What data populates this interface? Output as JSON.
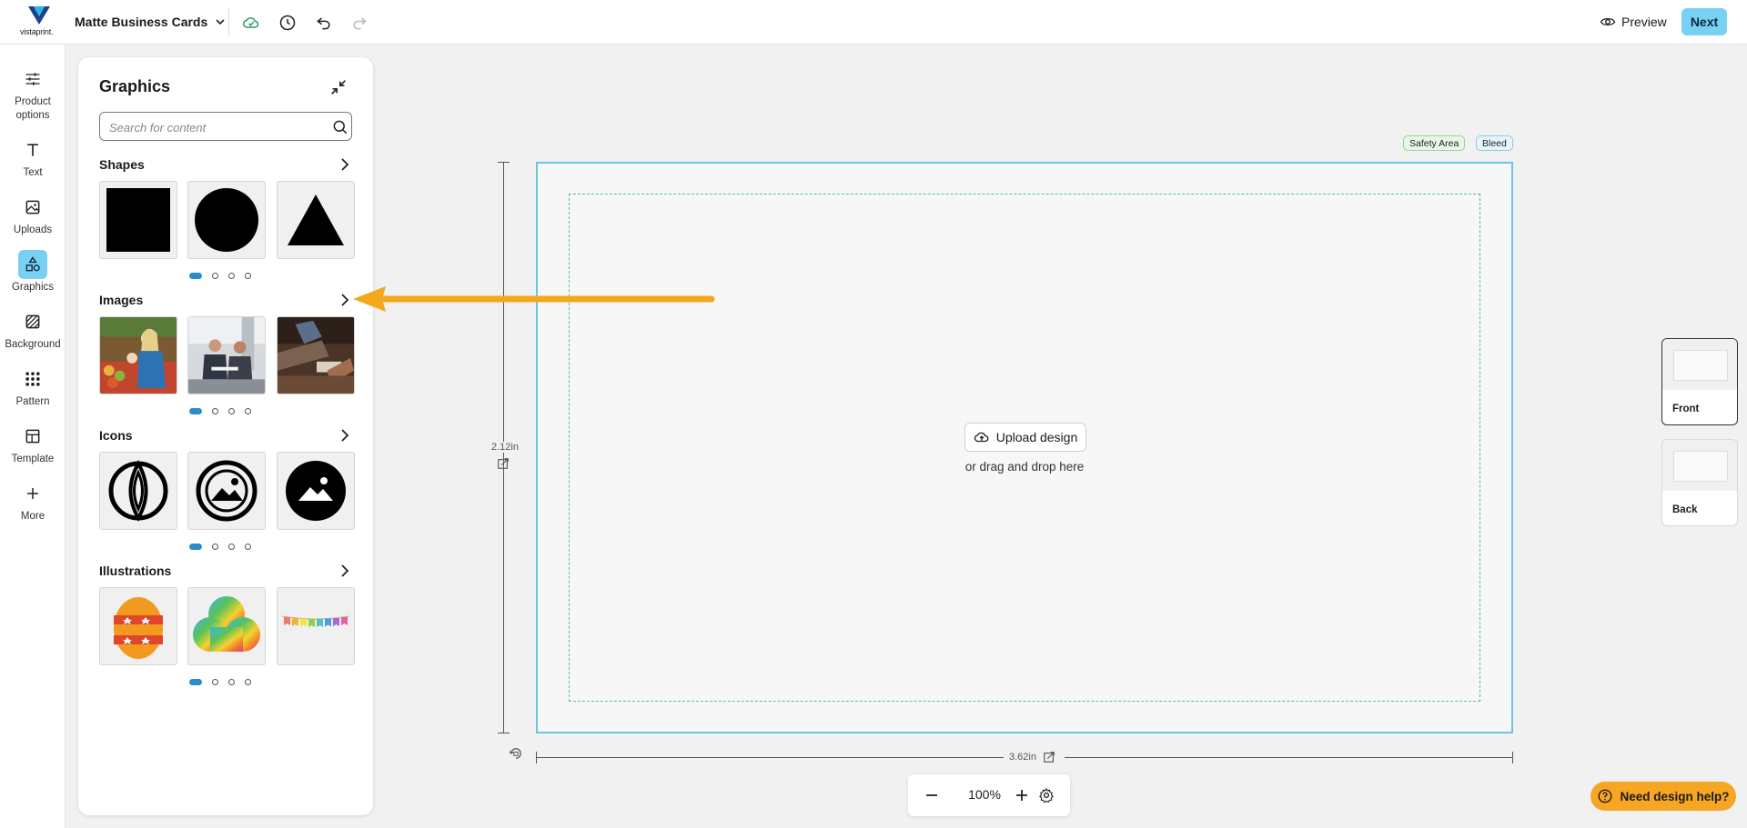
{
  "header": {
    "logo_text": "vistaprint.",
    "product_name": "Matte Business Cards",
    "preview_label": "Preview",
    "next_label": "Next"
  },
  "rail": {
    "items": [
      {
        "label": "Product options",
        "icon": "sliders-icon"
      },
      {
        "label": "Text",
        "icon": "text-icon"
      },
      {
        "label": "Uploads",
        "icon": "image-upload-icon"
      },
      {
        "label": "Graphics",
        "icon": "shapes-icon",
        "active": true
      },
      {
        "label": "Background",
        "icon": "hatch-icon"
      },
      {
        "label": "Pattern",
        "icon": "grid-dots-icon"
      },
      {
        "label": "Template",
        "icon": "template-icon"
      },
      {
        "label": "More",
        "icon": "plus-icon"
      }
    ]
  },
  "panel": {
    "title": "Graphics",
    "search_placeholder": "Search for content",
    "sections": [
      {
        "label": "Shapes"
      },
      {
        "label": "Images"
      },
      {
        "label": "Icons"
      },
      {
        "label": "Illustrations"
      }
    ]
  },
  "canvas": {
    "safety_label": "Safety Area",
    "bleed_label": "Bleed",
    "height_label": "2.12in",
    "width_label": "3.62in",
    "upload_label": "Upload design",
    "drag_text": "or drag and drop here"
  },
  "zoom": {
    "value": "100%"
  },
  "pages": {
    "front": "Front",
    "back": "Back"
  },
  "help": {
    "label": "Need design help?"
  },
  "colors": {
    "accent": "#78d0f2",
    "help": "#f6a623",
    "annotation_arrow": "#f5a81c"
  }
}
